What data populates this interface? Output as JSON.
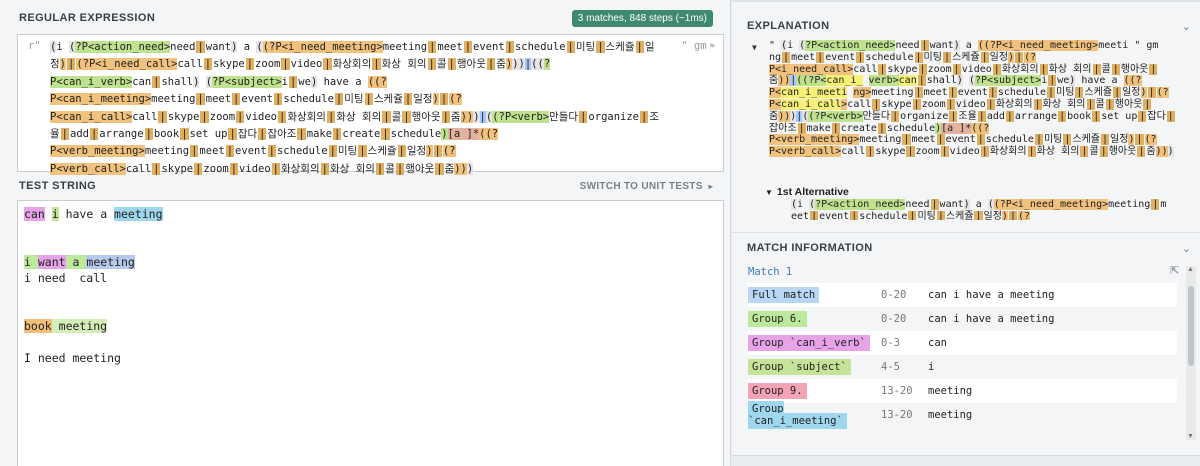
{
  "regex_panel": {
    "title": "REGULAR EXPRESSION",
    "badge": "3 matches, 848 steps (~1ms)",
    "delimiter_open": "r\"",
    "flags": "\" gm"
  },
  "test_panel": {
    "title": "TEST STRING",
    "switch_label": "SWITCH TO UNIT TESTS"
  },
  "test_lines": {
    "line1": {
      "w1": "can",
      "s1": " ",
      "w2": "i",
      "s2": " have a ",
      "w3": "meeting"
    },
    "line3": {
      "w1": "i",
      "s1": " ",
      "w2": "want",
      "s2": " ",
      "w3": "a",
      "s3": " ",
      "w4": "meeting"
    },
    "line4": "i need  call",
    "line6": {
      "w1": "book",
      "s1": " ",
      "w2": "meeting"
    },
    "line8": "I need meeting"
  },
  "explanation": {
    "title": "EXPLANATION",
    "alt1_label": "1st Alternative"
  },
  "match_info": {
    "title": "MATCH INFORMATION",
    "match_label": "Match 1",
    "rows": [
      {
        "name": "Full match",
        "range": "0-20",
        "value": "can i have a meeting"
      },
      {
        "name": "Group 6.",
        "range": "0-20",
        "value": "can i have a meeting"
      },
      {
        "name": "Group `can_i_verb`",
        "range": "0-3",
        "value": "can"
      },
      {
        "name": "Group `subject`",
        "range": "4-5",
        "value": "i"
      },
      {
        "name": "Group 9.",
        "range": "13-20",
        "value": "meeting"
      },
      {
        "name": "Group `can_i_meeting`",
        "range": "13-20",
        "value": "meeting"
      }
    ]
  },
  "colors": {
    "badge": "#3f8a6e",
    "group_orange": "#f1c27d",
    "group_green": "#bfe28f",
    "match_pink": "#e6a3e8",
    "match_cyan": "#9fd8ee",
    "link_blue": "#3a7bbd"
  },
  "icons": {
    "flag": "flag-icon",
    "collapse": "chevron-down-icon",
    "share": "share-icon",
    "arrow": "chevron-right-icon"
  }
}
